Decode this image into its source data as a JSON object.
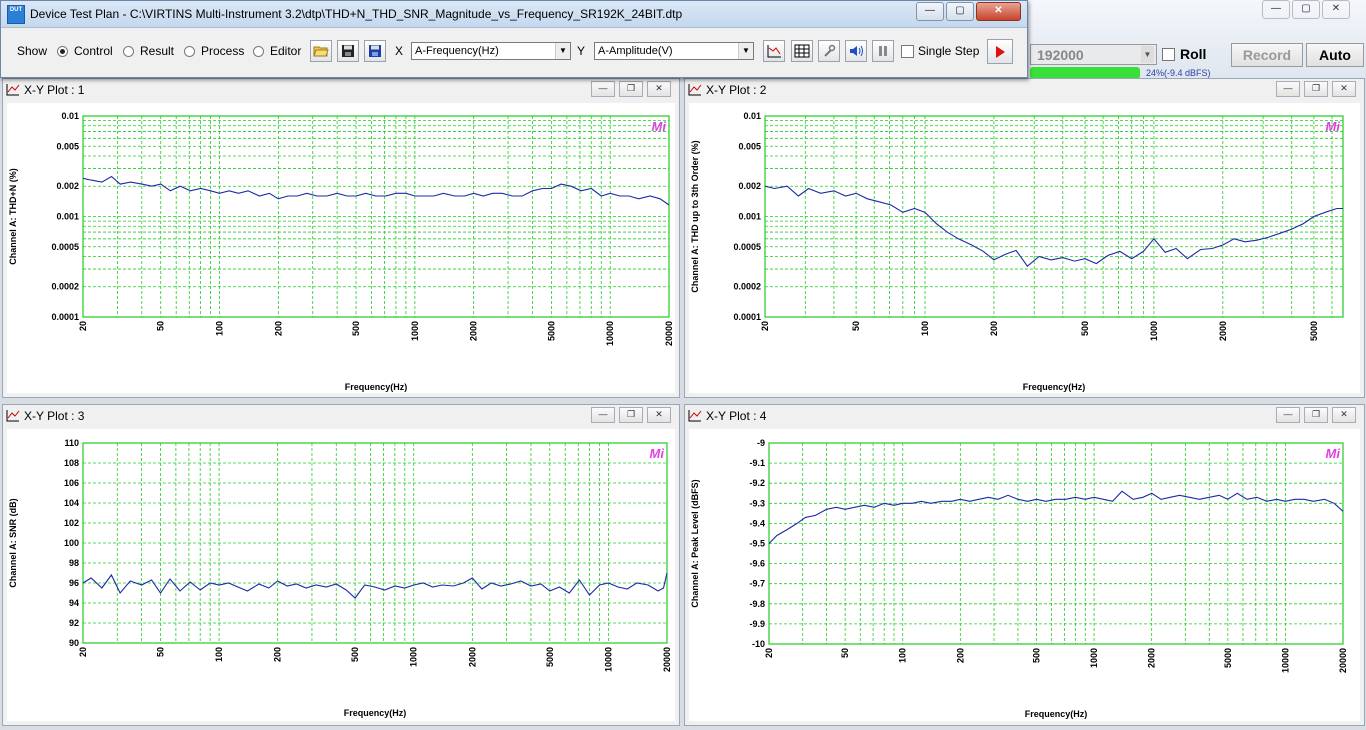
{
  "window": {
    "title": "Device Test Plan - C:\\VIRTINS Multi-Instrument 3.2\\dtp\\THD+N_THD_SNR_Magnitude_vs_Frequency_SR192K_24BIT.dtp",
    "icon_text": "DUT",
    "min_label": "—",
    "max_label": "▢",
    "close_label": "✕"
  },
  "toolbar": {
    "show_label": "Show",
    "modes": [
      {
        "label": "Control",
        "selected": true
      },
      {
        "label": "Result",
        "selected": false
      },
      {
        "label": "Process",
        "selected": false
      },
      {
        "label": "Editor",
        "selected": false
      }
    ],
    "x_label": "X",
    "x_value": "A-Frequency(Hz)",
    "y_label": "Y",
    "y_value": "A-Amplitude(V)",
    "single_step_label": "Single Step",
    "single_step_checked": false
  },
  "background_app": {
    "samplerate_value": "192000",
    "roll_label": "Roll",
    "record_label": "Record",
    "auto_label": "Auto",
    "partial_text": "24%(-9.4 dBFS)"
  },
  "plots": [
    {
      "title": "X-Y Plot : 1",
      "logo": "Mi",
      "xlabel": "Frequency(Hz)",
      "ylabel": "Channel A: THD+N (%)",
      "chart_data": {
        "type": "line",
        "title": "X-Y Plot : 1",
        "xlabel": "Frequency(Hz)",
        "ylabel": "Channel A: THD+N (%)",
        "x_scale": "log",
        "y_scale": "log",
        "xlim": [
          20,
          20000
        ],
        "ylim": [
          0.0001,
          0.01
        ],
        "x_ticks": [
          20,
          50,
          100,
          200,
          500,
          1000,
          2000,
          5000,
          10000,
          20000
        ],
        "x_tick_labels": [
          "20",
          "50",
          "100",
          "200",
          "500",
          "1000",
          "2000",
          "5000",
          "10000",
          "20000"
        ],
        "y_ticks": [
          0.0001,
          0.0002,
          0.0005,
          0.001,
          0.002,
          0.005,
          0.01
        ],
        "y_tick_labels": [
          "0.0001",
          "0.0002",
          "0.0005",
          "0.001",
          "0.002",
          "0.005",
          "0.01"
        ],
        "grid": true,
        "series": [
          {
            "color": "#1c2aa8",
            "x": [
              20,
              22,
              25,
              28,
              31,
              35,
              40,
              45,
              50,
              56,
              63,
              71,
              80,
              90,
              100,
              112,
              125,
              140,
              160,
              180,
              200,
              224,
              250,
              280,
              315,
              355,
              400,
              450,
              500,
              560,
              630,
              710,
              800,
              900,
              1000,
              1120,
              1250,
              1400,
              1600,
              1800,
              2000,
              2240,
              2500,
              2800,
              3150,
              3550,
              4000,
              4500,
              5000,
              5600,
              6300,
              7100,
              8000,
              9000,
              10000,
              11200,
              12500,
              14000,
              16000,
              18000,
              20000
            ],
            "y": [
              0.0024,
              0.0023,
              0.0022,
              0.0025,
              0.0021,
              0.0022,
              0.0021,
              0.002,
              0.0021,
              0.0018,
              0.002,
              0.0018,
              0.0019,
              0.0018,
              0.0017,
              0.0018,
              0.0017,
              0.0018,
              0.0016,
              0.0017,
              0.0015,
              0.0016,
              0.0016,
              0.0017,
              0.0016,
              0.0016,
              0.0017,
              0.0016,
              0.0016,
              0.0017,
              0.0016,
              0.0016,
              0.0017,
              0.0017,
              0.0016,
              0.0016,
              0.0016,
              0.0017,
              0.0016,
              0.0016,
              0.0017,
              0.0016,
              0.0017,
              0.0017,
              0.0016,
              0.0016,
              0.0018,
              0.0019,
              0.0019,
              0.0021,
              0.002,
              0.0018,
              0.0019,
              0.0016,
              0.0017,
              0.0016,
              0.0016,
              0.0015,
              0.0016,
              0.0015,
              0.0013
            ]
          }
        ]
      }
    },
    {
      "title": "X-Y Plot : 2",
      "logo": "Mi",
      "xlabel": "Frequency(Hz)",
      "ylabel": "Channel A: THD up to 3th Order (%)",
      "chart_data": {
        "type": "line",
        "title": "X-Y Plot : 2",
        "xlabel": "Frequency(Hz)",
        "ylabel": "Channel A: THD up to 3th Order (%)",
        "x_scale": "log",
        "y_scale": "log",
        "xlim": [
          20,
          6700
        ],
        "ylim": [
          0.0001,
          0.01
        ],
        "x_ticks": [
          20,
          50,
          100,
          200,
          500,
          1000,
          2000,
          5000
        ],
        "x_tick_labels": [
          "20",
          "50",
          "100",
          "200",
          "500",
          "1000",
          "2000",
          "5000"
        ],
        "y_ticks": [
          0.0001,
          0.0002,
          0.0005,
          0.001,
          0.002,
          0.005,
          0.01
        ],
        "y_tick_labels": [
          "0.0001",
          "0.0002",
          "0.0005",
          "0.001",
          "0.002",
          "0.005",
          "0.01"
        ],
        "grid": true,
        "series": [
          {
            "color": "#1c2aa8",
            "x": [
              20,
              22,
              25,
              28,
              31,
              35,
              40,
              45,
              50,
              56,
              63,
              71,
              80,
              90,
              100,
              112,
              125,
              140,
              160,
              180,
              200,
              224,
              250,
              280,
              315,
              355,
              400,
              450,
              500,
              560,
              630,
              710,
              800,
              900,
              1000,
              1120,
              1250,
              1400,
              1600,
              1800,
              2000,
              2240,
              2500,
              2800,
              3150,
              3550,
              4000,
              4500,
              5000,
              5600,
              6300,
              6700
            ],
            "y": [
              0.002,
              0.0019,
              0.002,
              0.0016,
              0.0019,
              0.0017,
              0.0018,
              0.0016,
              0.0017,
              0.0015,
              0.0014,
              0.0013,
              0.0011,
              0.0012,
              0.0011,
              0.00085,
              0.0007,
              0.0006,
              0.00052,
              0.00045,
              0.00037,
              0.00042,
              0.00046,
              0.00032,
              0.0004,
              0.00037,
              0.00039,
              0.00036,
              0.00038,
              0.00034,
              0.00041,
              0.00045,
              0.00038,
              0.00045,
              0.0006,
              0.00044,
              0.00048,
              0.00038,
              0.00047,
              0.00048,
              0.00052,
              0.0006,
              0.00056,
              0.00058,
              0.00062,
              0.00068,
              0.00075,
              0.00085,
              0.001,
              0.0011,
              0.0012,
              0.0012
            ]
          }
        ]
      }
    },
    {
      "title": "X-Y Plot : 3",
      "logo": "Mi",
      "xlabel": "Frequency(Hz)",
      "ylabel": "Channel A: SNR (dB)",
      "chart_data": {
        "type": "line",
        "title": "X-Y Plot : 3",
        "xlabel": "Frequency(Hz)",
        "ylabel": "Channel A: SNR (dB)",
        "x_scale": "log",
        "y_scale": "linear",
        "xlim": [
          20,
          20000
        ],
        "ylim": [
          90,
          110
        ],
        "x_ticks": [
          20,
          50,
          100,
          200,
          500,
          1000,
          2000,
          5000,
          10000,
          20000
        ],
        "x_tick_labels": [
          "20",
          "50",
          "100",
          "200",
          "500",
          "1000",
          "2000",
          "5000",
          "10000",
          "20000"
        ],
        "y_ticks": [
          90,
          92,
          94,
          96,
          98,
          100,
          102,
          104,
          106,
          108,
          110
        ],
        "y_tick_labels": [
          "90",
          "92",
          "94",
          "96",
          "98",
          "100",
          "102",
          "104",
          "106",
          "108",
          "110"
        ],
        "grid": true,
        "series": [
          {
            "color": "#1c2aa8",
            "x": [
              20,
              22,
              25,
              28,
              31,
              35,
              40,
              45,
              50,
              56,
              63,
              71,
              80,
              90,
              100,
              112,
              125,
              140,
              160,
              180,
              200,
              224,
              250,
              280,
              315,
              355,
              400,
              450,
              500,
              560,
              630,
              710,
              800,
              900,
              1000,
              1120,
              1250,
              1400,
              1600,
              1800,
              2000,
              2240,
              2500,
              2800,
              3150,
              3550,
              4000,
              4500,
              5000,
              5600,
              6300,
              7100,
              8000,
              9000,
              10000,
              11200,
              12500,
              14000,
              16000,
              18000,
              19200,
              20000
            ],
            "y": [
              96.0,
              96.5,
              95.5,
              96.8,
              95.0,
              96.2,
              95.8,
              96.3,
              95.0,
              96.4,
              95.2,
              96.1,
              95.3,
              96.0,
              95.8,
              96.0,
              95.6,
              95.2,
              95.9,
              95.5,
              96.2,
              95.7,
              95.9,
              95.5,
              95.8,
              95.6,
              95.9,
              95.3,
              94.5,
              95.8,
              95.6,
              95.3,
              95.7,
              95.5,
              95.8,
              96.0,
              95.6,
              95.8,
              95.7,
              96.0,
              96.5,
              95.4,
              96.0,
              95.7,
              95.9,
              96.2,
              95.7,
              95.9,
              95.2,
              95.6,
              95.0,
              96.3,
              94.8,
              95.8,
              96.0,
              95.6,
              95.4,
              96.0,
              95.8,
              95.2,
              95.5,
              97.0
            ]
          }
        ]
      }
    },
    {
      "title": "X-Y Plot : 4",
      "logo": "Mi",
      "xlabel": "Frequency(Hz)",
      "ylabel": "Channel A: Peak Level (dBFS)",
      "chart_data": {
        "type": "line",
        "title": "X-Y Plot : 4",
        "xlabel": "Frequency(Hz)",
        "ylabel": "Channel A: Peak Level (dBFS)",
        "x_scale": "log",
        "y_scale": "linear",
        "xlim": [
          20,
          20000
        ],
        "ylim": [
          -10,
          -9
        ],
        "x_ticks": [
          20,
          50,
          100,
          200,
          500,
          1000,
          2000,
          5000,
          10000,
          20000
        ],
        "x_tick_labels": [
          "20",
          "50",
          "100",
          "200",
          "500",
          "1000",
          "2000",
          "5000",
          "10000",
          "20000"
        ],
        "y_ticks": [
          -10,
          -9.9,
          -9.8,
          -9.7,
          -9.6,
          -9.5,
          -9.4,
          -9.3,
          -9.2,
          -9.1,
          -9
        ],
        "y_tick_labels": [
          "-10",
          "-9.9",
          "-9.8",
          "-9.7",
          "-9.6",
          "-9.5",
          "-9.4",
          "-9.3",
          "-9.2",
          "-9.1",
          "-9"
        ],
        "grid": true,
        "series": [
          {
            "color": "#1c2aa8",
            "x": [
              20,
              22,
              25,
              28,
              31,
              35,
              40,
              45,
              50,
              56,
              63,
              71,
              80,
              90,
              100,
              112,
              125,
              140,
              160,
              180,
              200,
              224,
              250,
              280,
              315,
              355,
              400,
              450,
              500,
              560,
              630,
              710,
              800,
              900,
              1000,
              1120,
              1250,
              1400,
              1600,
              1800,
              2000,
              2240,
              2500,
              2800,
              3150,
              3550,
              4000,
              4500,
              5000,
              5600,
              6300,
              7100,
              8000,
              9000,
              10000,
              11200,
              12500,
              14000,
              16000,
              18000,
              20000
            ],
            "y": [
              -9.5,
              -9.46,
              -9.43,
              -9.4,
              -9.37,
              -9.36,
              -9.33,
              -9.32,
              -9.33,
              -9.32,
              -9.31,
              -9.32,
              -9.3,
              -9.31,
              -9.3,
              -9.3,
              -9.29,
              -9.3,
              -9.29,
              -9.29,
              -9.28,
              -9.29,
              -9.28,
              -9.27,
              -9.28,
              -9.26,
              -9.28,
              -9.29,
              -9.28,
              -9.29,
              -9.28,
              -9.28,
              -9.27,
              -9.28,
              -9.27,
              -9.28,
              -9.29,
              -9.24,
              -9.28,
              -9.27,
              -9.25,
              -9.28,
              -9.27,
              -9.26,
              -9.27,
              -9.28,
              -9.27,
              -9.26,
              -9.28,
              -9.25,
              -9.28,
              -9.27,
              -9.29,
              -9.28,
              -9.29,
              -9.28,
              -9.28,
              -9.29,
              -9.28,
              -9.3,
              -9.34
            ]
          }
        ]
      }
    }
  ]
}
